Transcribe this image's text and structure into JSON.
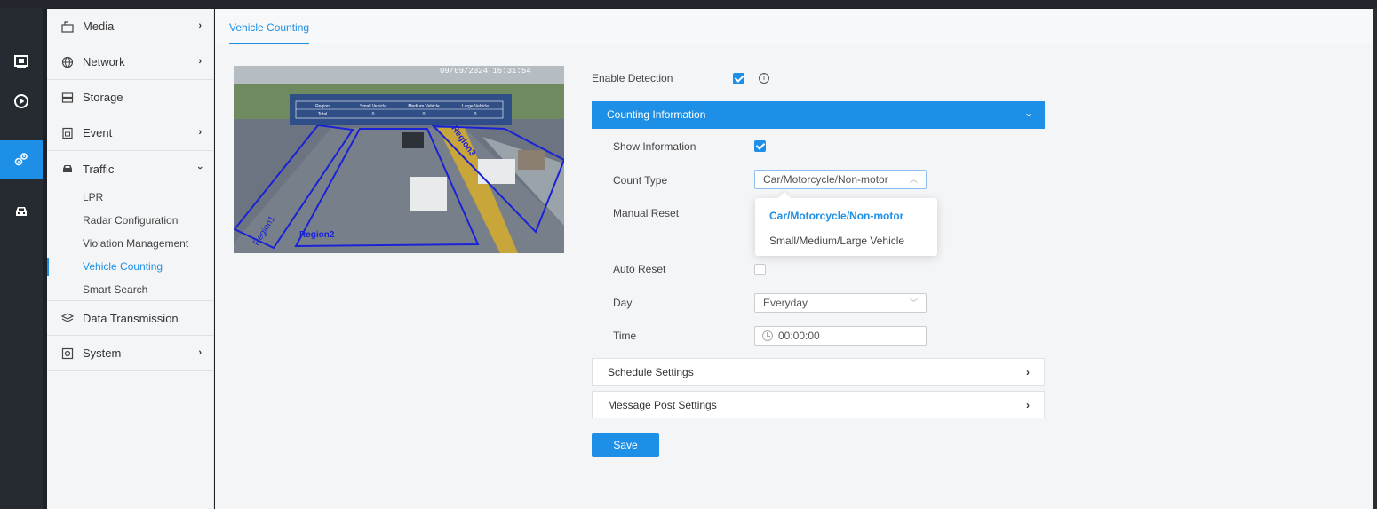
{
  "nav": {
    "media": "Media",
    "network": "Network",
    "storage": "Storage",
    "event": "Event",
    "traffic": "Traffic",
    "traffic_sub": [
      "LPR",
      "Radar Configuration",
      "Violation Management",
      "Vehicle Counting",
      "Smart Search"
    ],
    "data_transmission": "Data Transmission",
    "system": "System"
  },
  "tab": "Vehicle Counting",
  "preview": {
    "timestamp": "09/09/2024 16:31:54",
    "overlay_headers": [
      "Region",
      "Small Vehicle",
      "Medium Vehicle",
      "Large Vehicle"
    ],
    "overlay_row": [
      "Total",
      "0",
      "0",
      "0"
    ],
    "regions": [
      "Region1",
      "Region2",
      "Region3"
    ]
  },
  "form": {
    "enable_detection": "Enable Detection",
    "enable_detection_checked": true,
    "counting_information": "Counting Information",
    "show_information": "Show Information",
    "show_information_checked": true,
    "count_type": "Count Type",
    "count_type_value": "Car/Motorcycle/Non-motor",
    "count_type_options": [
      "Car/Motorcycle/Non-motor",
      "Small/Medium/Large Vehicle"
    ],
    "manual_reset": "Manual Reset",
    "auto_reset": "Auto Reset",
    "auto_reset_checked": false,
    "day": "Day",
    "day_value": "Everyday",
    "time": "Time",
    "time_value": "00:00:00",
    "schedule_settings": "Schedule Settings",
    "message_post_settings": "Message Post Settings",
    "save": "Save"
  },
  "colors": {
    "accent": "#1d8fe6",
    "rail": "#262a31",
    "region_line": "#1a22d6"
  }
}
